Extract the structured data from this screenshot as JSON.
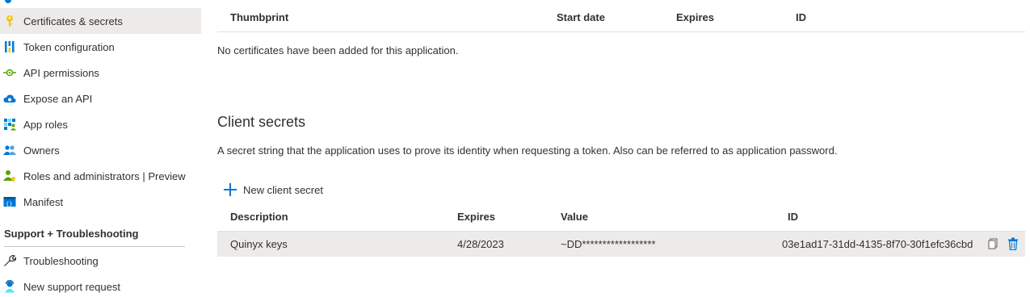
{
  "sidebar": {
    "items": [
      {
        "label": "Certificates & secrets",
        "icon": "key-icon"
      },
      {
        "label": "Token configuration",
        "icon": "token-icon"
      },
      {
        "label": "API permissions",
        "icon": "api-permissions-icon"
      },
      {
        "label": "Expose an API",
        "icon": "cloud-icon"
      },
      {
        "label": "App roles",
        "icon": "app-roles-icon"
      },
      {
        "label": "Owners",
        "icon": "owners-icon"
      },
      {
        "label": "Roles and administrators | Preview",
        "icon": "roles-admin-icon"
      },
      {
        "label": "Manifest",
        "icon": "manifest-icon"
      }
    ],
    "support_header": "Support + Troubleshooting",
    "support_items": [
      {
        "label": "Troubleshooting",
        "icon": "wrench-icon"
      },
      {
        "label": "New support request",
        "icon": "support-person-icon"
      }
    ]
  },
  "certificates": {
    "columns": [
      "Thumbprint",
      "Start date",
      "Expires",
      "ID"
    ],
    "empty_message": "No certificates have been added for this application."
  },
  "client_secrets": {
    "title": "Client secrets",
    "description": "A secret string that the application uses to prove its identity when requesting a token. Also can be referred to as application password.",
    "new_button_label": "New client secret",
    "columns": [
      "Description",
      "Expires",
      "Value",
      "ID"
    ],
    "rows": [
      {
        "description": "Quinyx keys",
        "expires": "4/28/2023",
        "value": "~DD******************",
        "id": "03e1ad17-31dd-4135-8f70-30f1efc36cbd"
      }
    ]
  },
  "colors": {
    "accent": "#0078d4",
    "active_bg": "#edebe9"
  }
}
